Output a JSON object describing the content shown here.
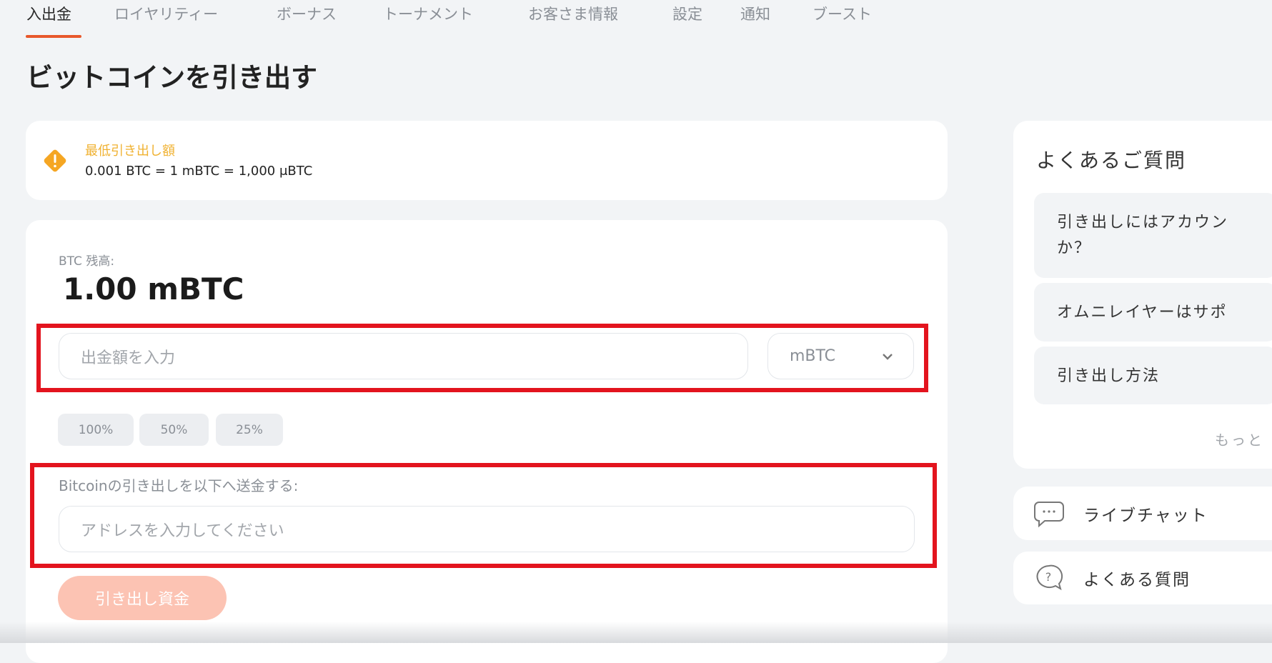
{
  "tabs": [
    {
      "label": "入出金",
      "active": true
    },
    {
      "label": "ロイヤリティー"
    },
    {
      "label": "ボーナス"
    },
    {
      "label": "トーナメント"
    },
    {
      "label": "お客さま情報"
    },
    {
      "label": "設定"
    },
    {
      "label": "通知"
    },
    {
      "label": "ブースト"
    }
  ],
  "page_title": "ビットコインを引き出す",
  "notice": {
    "icon": "warning-icon",
    "title": "最低引き出し額",
    "text": "0.001 BTC = 1 mBTC = 1,000 μBTC"
  },
  "balance": {
    "label": "BTC 残高:",
    "value": "1.00 mBTC"
  },
  "amount": {
    "placeholder": "出金額を入力",
    "currency": "mBTC"
  },
  "percent_buttons": [
    "100%",
    "50%",
    "25%"
  ],
  "address": {
    "label": "Bitcoinの引き出しを以下へ送金する:",
    "placeholder": "アドレスを入力してください"
  },
  "withdraw_button": "引き出し資金",
  "faq": {
    "title": "よくあるご質問",
    "items": [
      "引き出しにはアカウン\nか？",
      "オムニレイヤーはサポ",
      "引き出し方法"
    ],
    "more": "もっと"
  },
  "support": [
    {
      "label": "ライブチャット",
      "icon": "chat-bubble-icon"
    },
    {
      "label": "よくある質問",
      "icon": "question-bubble-icon"
    }
  ],
  "colors": {
    "accent": "#e8582b",
    "warning": "#f0b232",
    "highlight": "#e3141e",
    "button_disabled": "#fcc3b3"
  }
}
